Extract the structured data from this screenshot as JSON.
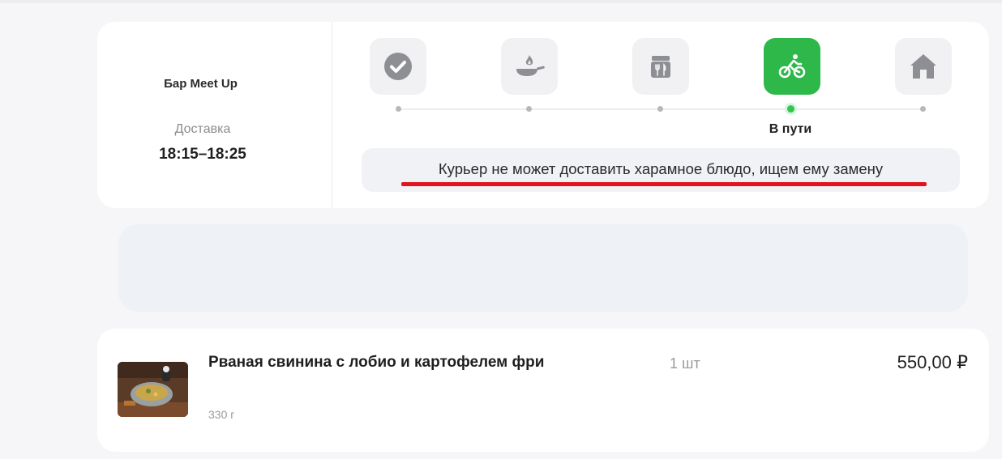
{
  "order": {
    "restaurant": "Бар Meet Up",
    "delivery_label": "Доставка",
    "delivery_time": "18:15–18:25"
  },
  "progress": {
    "steps": [
      {
        "icon": "check-icon",
        "state": "done"
      },
      {
        "icon": "frying-pan-icon",
        "state": "pending"
      },
      {
        "icon": "package-icon",
        "state": "pending"
      },
      {
        "icon": "bicycle-courier-icon",
        "state": "active"
      },
      {
        "icon": "home-icon",
        "state": "pending"
      }
    ],
    "active_label": "В пути",
    "active_color": "#2eb84a"
  },
  "message": {
    "text": "Курьер не может доставить харамное блюдо, ищем ему замену",
    "underline_color": "#e0141e"
  },
  "item": {
    "name": "Рваная свинина с лобио и картофелем фри",
    "weight": "330 г",
    "quantity": "1 шт",
    "price": "550,00 ₽"
  }
}
